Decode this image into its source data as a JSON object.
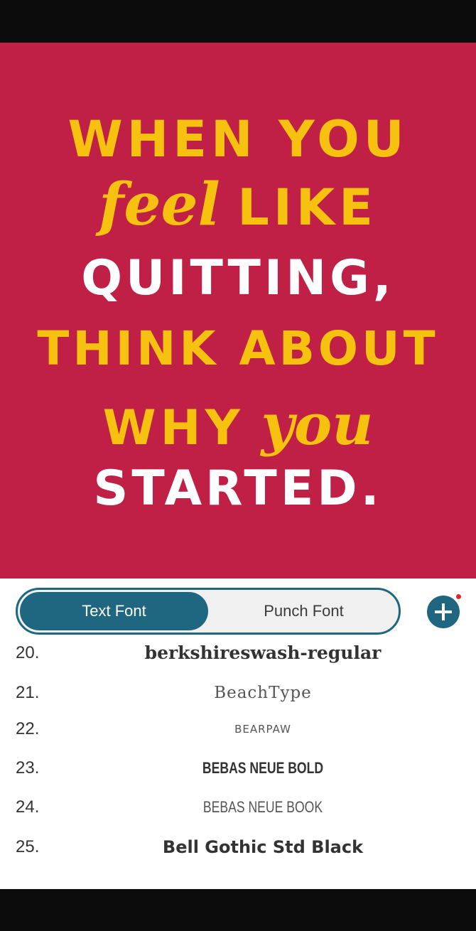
{
  "poster": {
    "lines": [
      {
        "parts": [
          "WHEN YOU"
        ]
      },
      {
        "parts": [
          "feel",
          "LIKE"
        ]
      },
      {
        "parts": [
          "QUITTING,"
        ]
      },
      {
        "parts": [
          "THINK ABOUT"
        ]
      },
      {
        "parts": [
          "WHY",
          "you"
        ]
      },
      {
        "parts": [
          "STARTED."
        ]
      }
    ],
    "background_color": "#c01f46",
    "accent_color": "#f6c20f"
  },
  "tabs": {
    "active": "Text Font",
    "inactive": "Punch Font"
  },
  "add_button": {
    "icon": "plus-icon",
    "color": "#1f6781"
  },
  "font_list": [
    {
      "number": "20.",
      "name": "berkshireswash-regular"
    },
    {
      "number": "21.",
      "name": "BeachType"
    },
    {
      "number": "22.",
      "name": "BEARPAW"
    },
    {
      "number": "23.",
      "name": "BEBAS NEUE BOLD"
    },
    {
      "number": "24.",
      "name": "BEBAS NEUE BOOK"
    },
    {
      "number": "25.",
      "name": "Bell Gothic Std Black"
    }
  ]
}
